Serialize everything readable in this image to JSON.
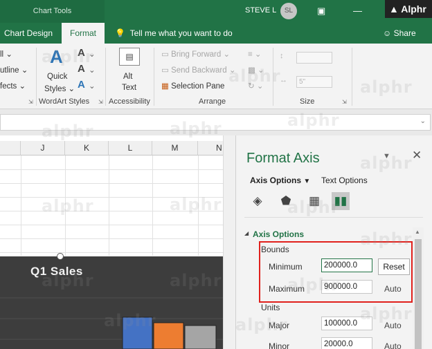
{
  "titlebar": {
    "context_tab": "Chart Tools",
    "user_name": "STEVE L",
    "user_initials": "SL",
    "logo_text": "Alphr"
  },
  "tabs": {
    "chart_design": "Chart Design",
    "format": "Format",
    "tell_me": "Tell me what you want to do",
    "share": "Share"
  },
  "ribbon": {
    "fill_partial": "ll",
    "outline_partial": "utline",
    "effects_partial": "fects",
    "quick_styles": "Quick",
    "quick_styles_2": "Styles",
    "alt_text": "Alt",
    "alt_text_2": "Text",
    "bring_forward": "Bring Forward",
    "send_backward": "Send Backward",
    "selection_pane": "Selection Pane",
    "height_value": "",
    "width_value": "5\"",
    "groups": {
      "wordart": "WordArt Styles",
      "accessibility": "Accessibility",
      "arrange": "Arrange",
      "size": "Size"
    }
  },
  "grid": {
    "columns": [
      "J",
      "K",
      "L",
      "M",
      "N"
    ]
  },
  "chart": {
    "title": "Q1 Sales",
    "bar_colors": [
      "#4472c4",
      "#ed7d31",
      "#a5a5a5"
    ]
  },
  "format_pane": {
    "title": "Format Axis",
    "tab_axis_options": "Axis Options",
    "tab_text_options": "Text Options",
    "section_axis_options": "Axis Options",
    "bounds_label": "Bounds",
    "minimum_label": "Minimum",
    "minimum_value": "200000.0",
    "maximum_label": "Maximum",
    "maximum_value": "900000.0",
    "reset_button": "Reset",
    "auto_label": "Auto",
    "units_label": "Units",
    "major_label": "Major",
    "major_value": "100000.0",
    "minor_label": "Minor",
    "minor_value": "20000.0"
  },
  "watermark_text": "alphr"
}
